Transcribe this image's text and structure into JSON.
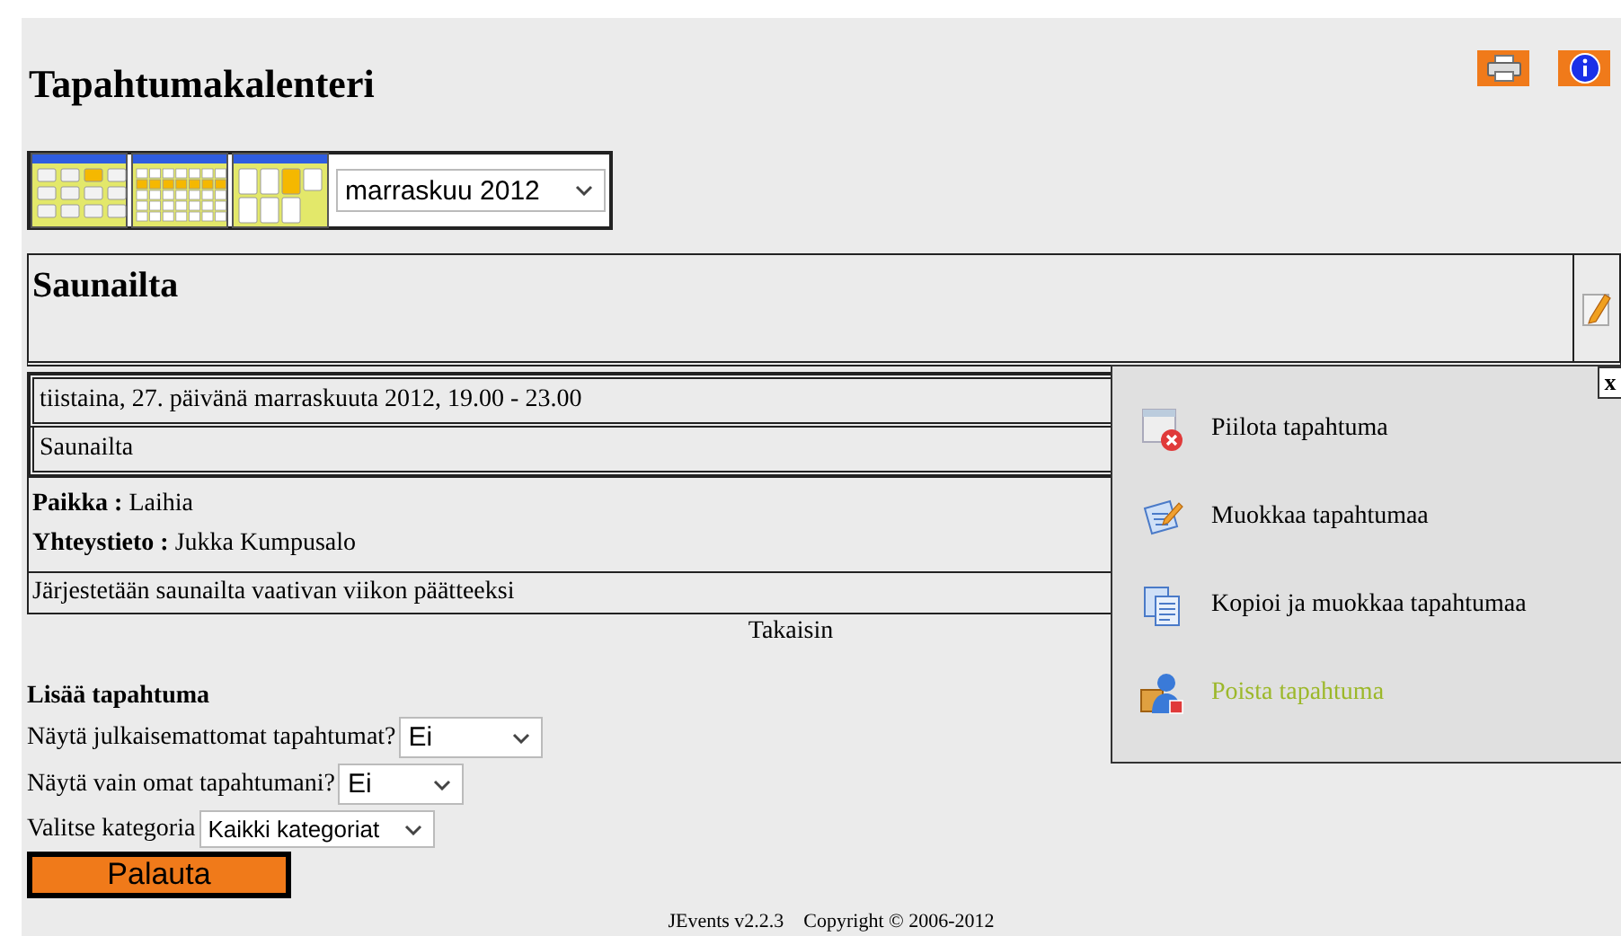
{
  "header": {
    "title": "Tapahtumakalenteri"
  },
  "views": [
    {
      "kind": "year"
    },
    {
      "kind": "month"
    },
    {
      "kind": "week"
    }
  ],
  "month_select": {
    "value": "marraskuu 2012"
  },
  "event": {
    "title": "Saunailta",
    "date": "tiistaina, 27. päivänä marraskuuta 2012, 19.00 - 23.00",
    "category": "Saunailta",
    "details": [
      {
        "label": "Paikka :",
        "value": "Laihia"
      },
      {
        "label": "Yhteystieto :",
        "value": "Jukka Kumpusalo"
      }
    ],
    "description": "Järjestetään saunailta vaativan viikon päätteeksi"
  },
  "back_link": "Takaisin",
  "popup": {
    "close": "x",
    "items": [
      {
        "kind": "hide",
        "label": "Piilota tapahtuma",
        "color": "#000000"
      },
      {
        "kind": "edit",
        "label": "Muokkaa tapahtumaa",
        "color": "#000000"
      },
      {
        "kind": "copy",
        "label": "Kopioi ja muokkaa tapahtumaa",
        "color": "#000000"
      },
      {
        "kind": "delete",
        "label": "Poista tapahtuma",
        "color": "#9cb82a"
      }
    ]
  },
  "add_event": "Lisää tapahtuma",
  "filters": [
    {
      "label": "Näytä julkaisemattomat tapahtumat?",
      "value": "Ei",
      "kind": "wide"
    },
    {
      "label": "Näytä vain omat tapahtumani?",
      "value": "Ei",
      "kind": "medium"
    },
    {
      "label": "Valitse kategoria",
      "value": "Kaikki kategoriat",
      "kind": "small"
    }
  ],
  "reset_button": "Palauta",
  "footer": "JEvents v2.2.3    Copyright © 2006-2012"
}
